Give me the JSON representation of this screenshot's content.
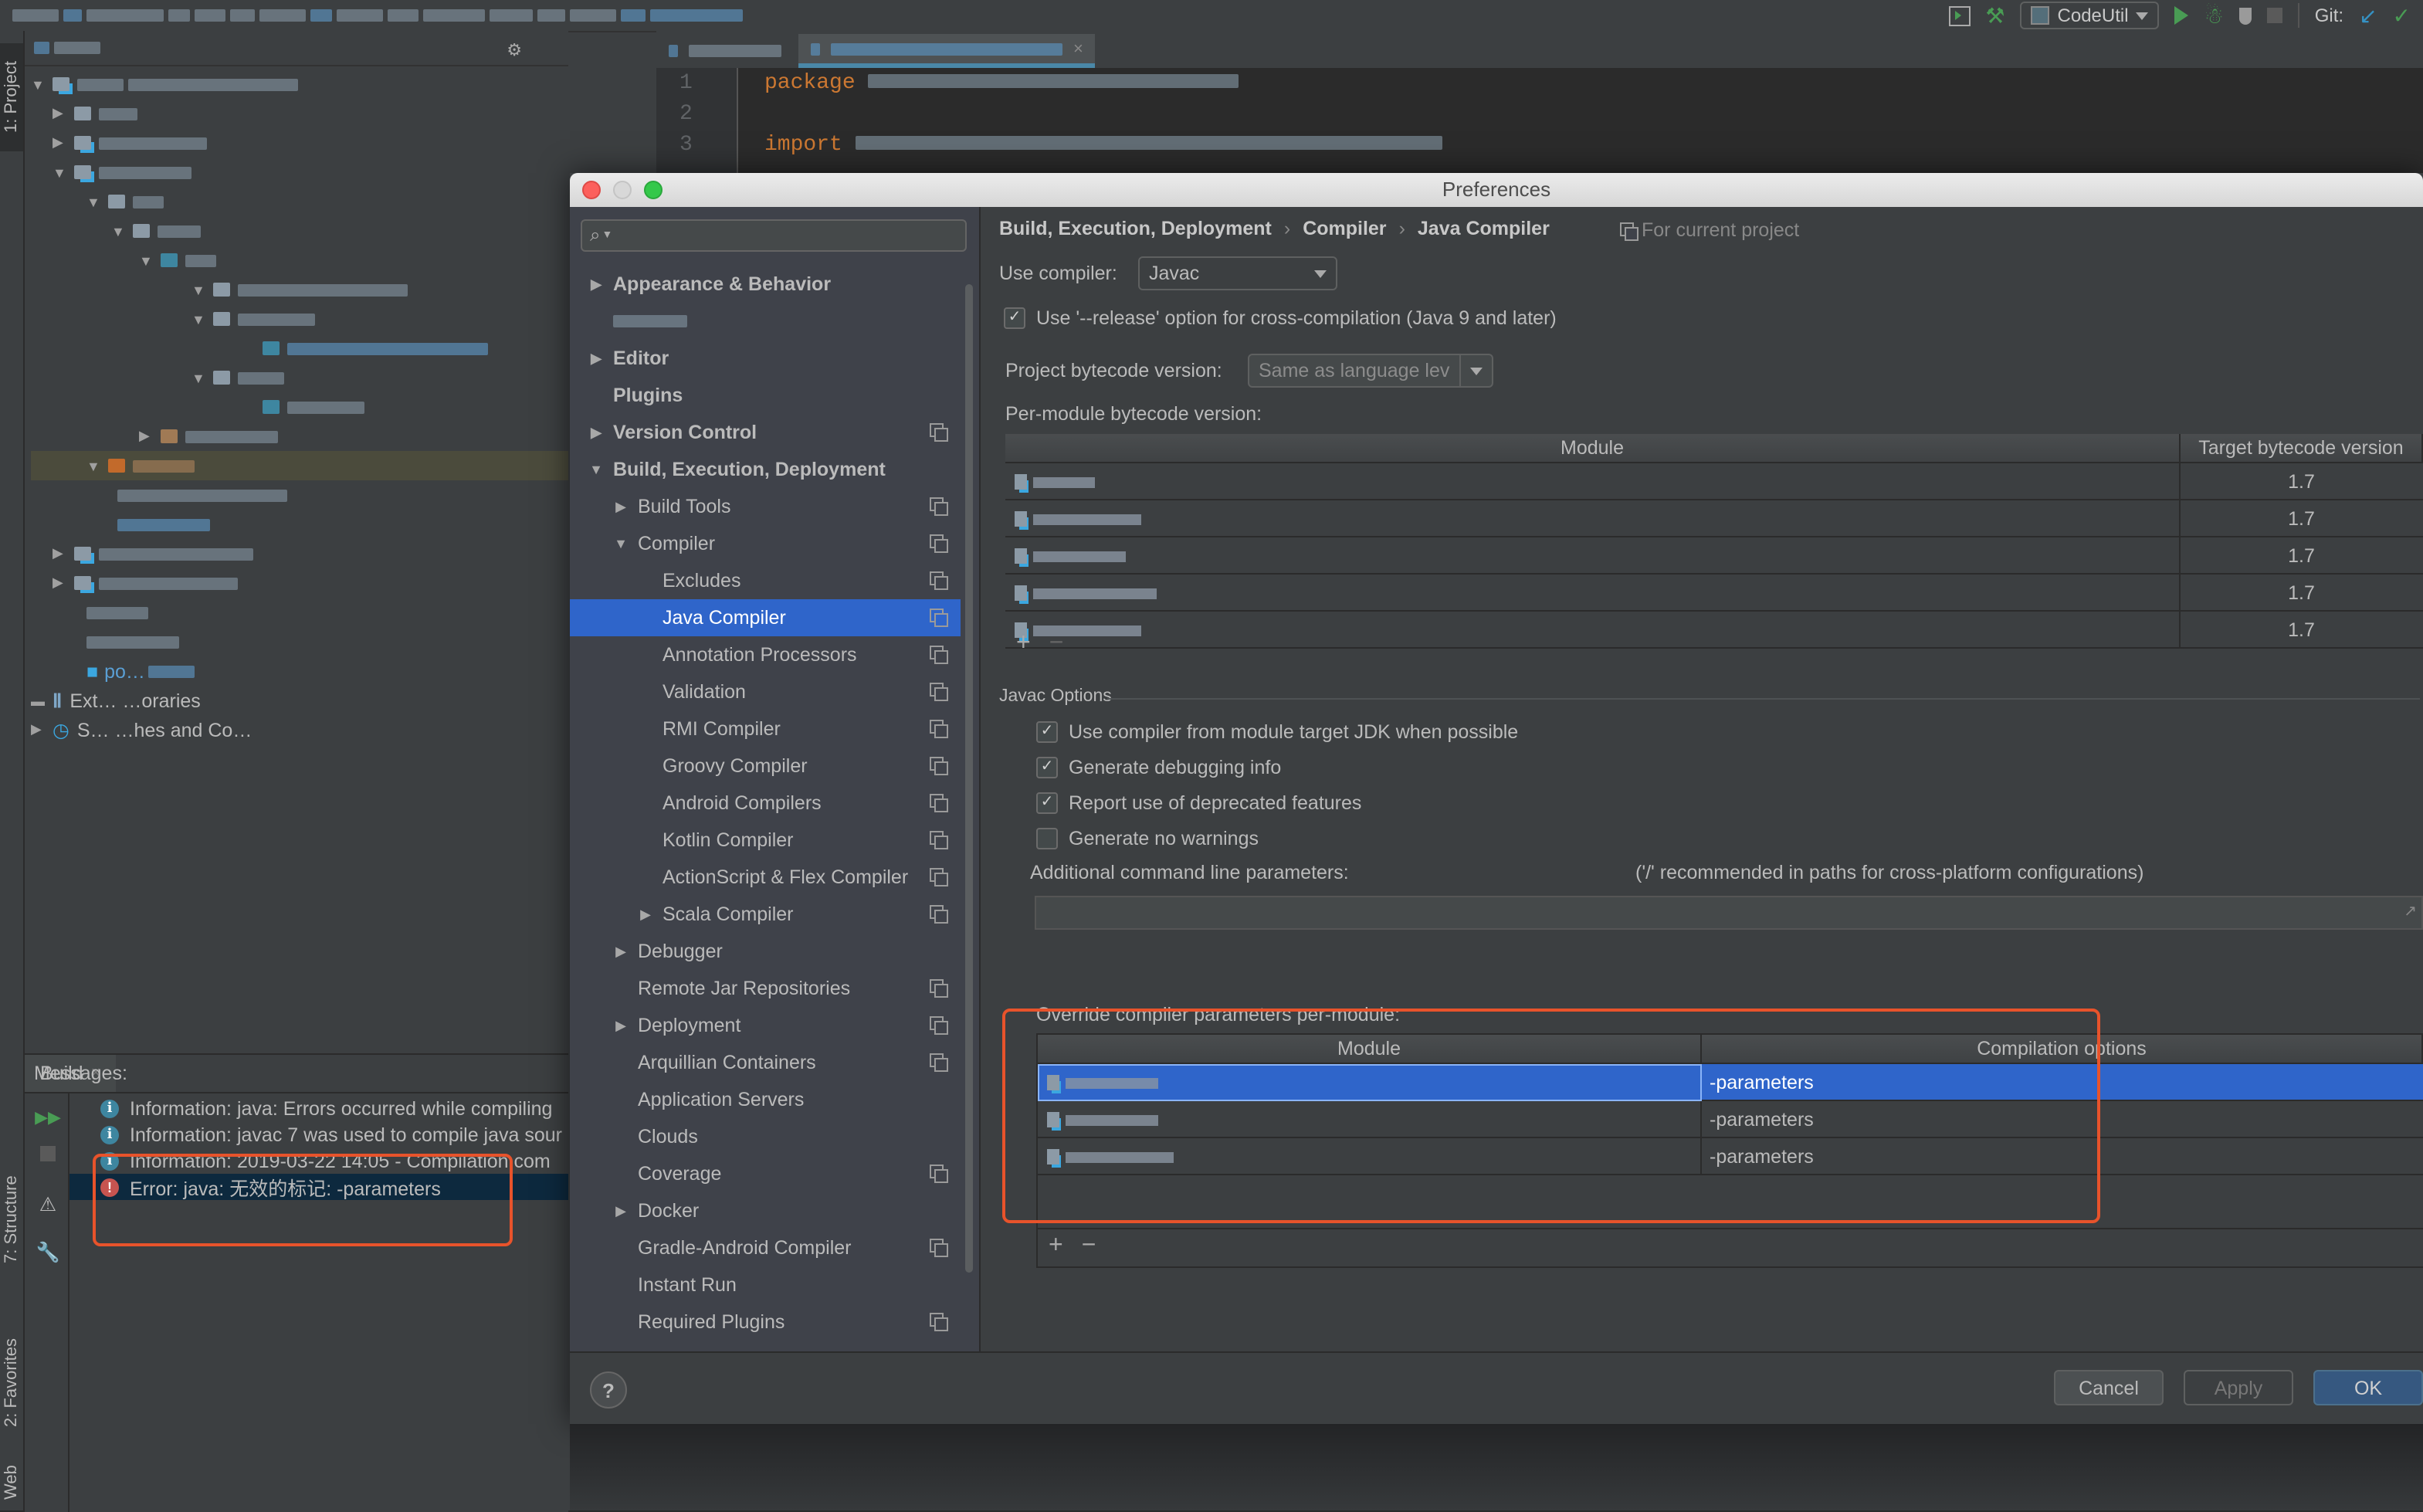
{
  "toolbar": {
    "run_config": "CodeUtil",
    "git_label": "Git:",
    "icons": [
      "layout-icon",
      "build-hammer-icon",
      "run-config-icon",
      "run-icon",
      "debug-icon",
      "coverage-icon",
      "stop-icon",
      "git-update-icon",
      "git-commit-icon"
    ]
  },
  "left_stripe": {
    "project_tab": "1: Project",
    "structure_tab": "7: Structure",
    "favorites_tab": "2: Favorites",
    "web_tab": "Web"
  },
  "project_tree": {
    "visible_items": [
      {
        "label": "External Libraries",
        "partial": "Ext… …oraries"
      },
      {
        "label": "Scratches and Consoles",
        "partial": "S… …hes and Co…"
      }
    ],
    "partial_text": "po…"
  },
  "editor": {
    "line_numbers": [
      "1",
      "2",
      "3"
    ],
    "line1_keyword": "package",
    "line3_keyword": "import"
  },
  "messages": {
    "label": "Messages:",
    "tab": "Build",
    "lines": [
      {
        "type": "info",
        "text": "Information: java: Errors occurred while compiling"
      },
      {
        "type": "info",
        "text": "Information: javac 7 was used to compile java sour"
      },
      {
        "type": "info",
        "text": "Information: 2019-03-22 14:05 - Compilation com"
      },
      {
        "type": "error",
        "text": "Error: java: 无效的标记: -parameters"
      }
    ]
  },
  "dialog": {
    "title": "Preferences",
    "search_placeholder": "",
    "breadcrumb": [
      "Build, Execution, Deployment",
      "Compiler",
      "Java Compiler"
    ],
    "scope_label": "For current project",
    "nav": [
      {
        "label": "Appearance & Behavior",
        "level": 0,
        "bold": true,
        "arrow": "collapsed",
        "proj": false
      },
      {
        "label": "",
        "level": 0,
        "bold": true,
        "arrow": "none",
        "proj": false,
        "redacted": true
      },
      {
        "label": "Editor",
        "level": 0,
        "bold": true,
        "arrow": "collapsed",
        "proj": false
      },
      {
        "label": "Plugins",
        "level": 0,
        "bold": true,
        "arrow": "none",
        "proj": false
      },
      {
        "label": "Version Control",
        "level": 0,
        "bold": true,
        "arrow": "collapsed",
        "proj": true
      },
      {
        "label": "Build, Execution, Deployment",
        "level": 0,
        "bold": true,
        "arrow": "expanded",
        "proj": false
      },
      {
        "label": "Build Tools",
        "level": 1,
        "bold": false,
        "arrow": "collapsed",
        "proj": true
      },
      {
        "label": "Compiler",
        "level": 1,
        "bold": false,
        "arrow": "expanded",
        "proj": true
      },
      {
        "label": "Excludes",
        "level": 2,
        "bold": false,
        "arrow": "none",
        "proj": true
      },
      {
        "label": "Java Compiler",
        "level": 2,
        "bold": false,
        "arrow": "none",
        "proj": true,
        "selected": true
      },
      {
        "label": "Annotation Processors",
        "level": 2,
        "bold": false,
        "arrow": "none",
        "proj": true
      },
      {
        "label": "Validation",
        "level": 2,
        "bold": false,
        "arrow": "none",
        "proj": true
      },
      {
        "label": "RMI Compiler",
        "level": 2,
        "bold": false,
        "arrow": "none",
        "proj": true
      },
      {
        "label": "Groovy Compiler",
        "level": 2,
        "bold": false,
        "arrow": "none",
        "proj": true
      },
      {
        "label": "Android Compilers",
        "level": 2,
        "bold": false,
        "arrow": "none",
        "proj": true
      },
      {
        "label": "Kotlin Compiler",
        "level": 2,
        "bold": false,
        "arrow": "none",
        "proj": true
      },
      {
        "label": "ActionScript & Flex Compiler",
        "level": 2,
        "bold": false,
        "arrow": "none",
        "proj": true
      },
      {
        "label": "Scala Compiler",
        "level": 2,
        "bold": false,
        "arrow": "collapsed",
        "proj": true
      },
      {
        "label": "Debugger",
        "level": 1,
        "bold": false,
        "arrow": "collapsed",
        "proj": false
      },
      {
        "label": "Remote Jar Repositories",
        "level": 1,
        "bold": false,
        "arrow": "none",
        "proj": true
      },
      {
        "label": "Deployment",
        "level": 1,
        "bold": false,
        "arrow": "collapsed",
        "proj": true
      },
      {
        "label": "Arquillian Containers",
        "level": 1,
        "bold": false,
        "arrow": "none",
        "proj": true
      },
      {
        "label": "Application Servers",
        "level": 1,
        "bold": false,
        "arrow": "none",
        "proj": false
      },
      {
        "label": "Clouds",
        "level": 1,
        "bold": false,
        "arrow": "none",
        "proj": false
      },
      {
        "label": "Coverage",
        "level": 1,
        "bold": false,
        "arrow": "none",
        "proj": true
      },
      {
        "label": "Docker",
        "level": 1,
        "bold": false,
        "arrow": "collapsed",
        "proj": false
      },
      {
        "label": "Gradle-Android Compiler",
        "level": 1,
        "bold": false,
        "arrow": "none",
        "proj": true
      },
      {
        "label": "Instant Run",
        "level": 1,
        "bold": false,
        "arrow": "none",
        "proj": false
      },
      {
        "label": "Required Plugins",
        "level": 1,
        "bold": false,
        "arrow": "none",
        "proj": true
      }
    ],
    "content": {
      "use_compiler_label": "Use compiler:",
      "use_compiler_value": "Javac",
      "release_option_label": "Use '--release' option for cross-compilation (Java 9 and later)",
      "release_option_checked": true,
      "project_bytecode_label": "Project bytecode version:",
      "project_bytecode_value": "Same as language lev",
      "per_module_label": "Per-module bytecode version:",
      "bytecode_table": {
        "columns": [
          "Module",
          "Target bytecode version"
        ],
        "rows": [
          {
            "module": "",
            "version": "1.7"
          },
          {
            "module": "",
            "version": "1.7"
          },
          {
            "module": "",
            "version": "1.7"
          },
          {
            "module": "",
            "version": "1.7"
          },
          {
            "module": "",
            "version": "1.7"
          }
        ]
      },
      "javac_options_label": "Javac Options",
      "options": [
        {
          "label": "Use compiler from module target JDK when possible",
          "checked": true
        },
        {
          "label": "Generate debugging info",
          "checked": true
        },
        {
          "label": "Report use of deprecated features",
          "checked": true
        },
        {
          "label": "Generate no warnings",
          "checked": false
        }
      ],
      "additional_params_label": "Additional command line parameters:",
      "additional_params_hint": "('/' recommended in paths for cross-platform configurations)",
      "additional_params_value": "",
      "override_label": "Override compiler parameters per-module:",
      "override_table": {
        "columns": [
          "Module",
          "Compilation options"
        ],
        "rows": [
          {
            "module": "",
            "options": "-parameters",
            "selected": true
          },
          {
            "module": "",
            "options": "-parameters",
            "selected": false
          },
          {
            "module": "",
            "options": "-parameters",
            "selected": false
          }
        ]
      }
    },
    "buttons": {
      "help": "?",
      "cancel": "Cancel",
      "apply": "Apply",
      "ok": "OK"
    }
  },
  "colors": {
    "selection": "#2f65ca",
    "annotation_red": "#e8532b",
    "error_red": "#c75450",
    "info_blue": "#3e86a0"
  }
}
